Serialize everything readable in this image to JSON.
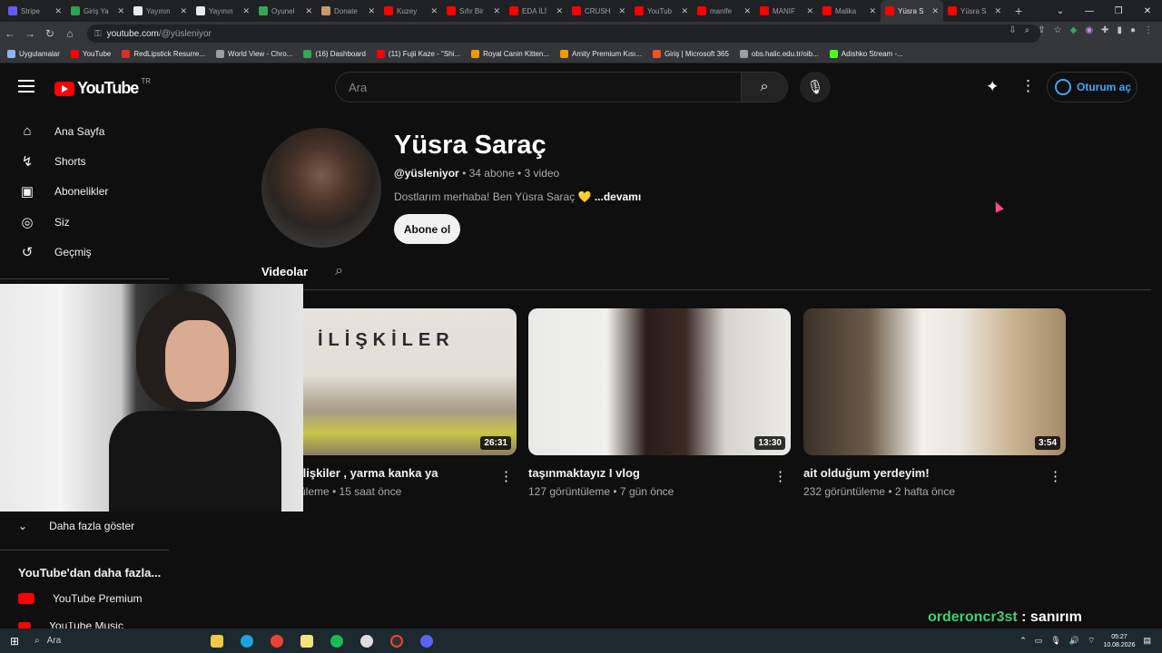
{
  "browser": {
    "tabs": [
      {
        "label": "Stripe",
        "color": "#635bff"
      },
      {
        "label": "Giriş Ya",
        "color": "#2ea44f"
      },
      {
        "label": "Yayının",
        "color": "#e8eaed"
      },
      {
        "label": "Yayının",
        "color": "#e8eaed"
      },
      {
        "label": "Oyunel",
        "color": "#34a853"
      },
      {
        "label": "Donate",
        "color": "#c49a6c"
      },
      {
        "label": "Kuzey",
        "color": "#ff0000"
      },
      {
        "label": "Sıfır Bir",
        "color": "#ff0000"
      },
      {
        "label": "EDA İLİ",
        "color": "#ff0000"
      },
      {
        "label": "CRUSH",
        "color": "#ff0000"
      },
      {
        "label": "YouTub",
        "color": "#ff0000"
      },
      {
        "label": "manife",
        "color": "#ff0000"
      },
      {
        "label": "MANIF",
        "color": "#ff0000"
      },
      {
        "label": "Malika",
        "color": "#ff0000"
      },
      {
        "label": "Yüsra S",
        "color": "#ff0000",
        "active": true
      },
      {
        "label": "Yüsra S",
        "color": "#ff0000"
      }
    ],
    "url_host": "youtube.com",
    "url_path": "/@yüsleniyor",
    "bookmarks": [
      {
        "label": "Uygulamalar",
        "color": "#8ab4f8"
      },
      {
        "label": "YouTube",
        "color": "#ff0000"
      },
      {
        "label": "RedLipstick Resurre...",
        "color": "#d93025"
      },
      {
        "label": "World View - Chro...",
        "color": "#9aa0a6"
      },
      {
        "label": "(16) Dashboard",
        "color": "#34a853"
      },
      {
        "label": "(11) Fujii Kaze - \"Shi...",
        "color": "#ff0000"
      },
      {
        "label": "Royal Canin Kitten...",
        "color": "#f29900"
      },
      {
        "label": "Amity Premium Kısı...",
        "color": "#f29900"
      },
      {
        "label": "Giriş | Microsoft 365",
        "color": "#f25022"
      },
      {
        "label": "obs.halic.edu.tr/oib...",
        "color": "#9aa0a6"
      },
      {
        "label": "Adishko Stream -...",
        "color": "#53fc18"
      }
    ]
  },
  "youtube": {
    "logo_text": "YouTube",
    "logo_region": "TR",
    "search_placeholder": "Ara",
    "sign_in": "Oturum aç",
    "nav": [
      {
        "label": "Ana Sayfa",
        "icon": "home-icon"
      },
      {
        "label": "Shorts",
        "icon": "shorts-icon"
      },
      {
        "label": "Abonelikler",
        "icon": "subscriptions-icon"
      },
      {
        "label": "Siz",
        "icon": "user-icon"
      },
      {
        "label": "Geçmiş",
        "icon": "history-icon"
      }
    ],
    "show_more": "Daha fazla göster",
    "from_youtube": "YouTube'dan daha fazla...",
    "premium": "YouTube Premium",
    "music": "YouTube Music"
  },
  "channel": {
    "name": "Yüsra Saraç",
    "handle": "@yüsleniyor",
    "stats": " • 34 abone • 3 video",
    "description": "Dostlarım merhaba! Ben Yüsra Saraç 💛",
    "more": "...devamı",
    "subscribe": "Abone ol",
    "tab_videos": "Videolar"
  },
  "videos": [
    {
      "title": "ilişkiler , yarma kanka ya",
      "meta": "üleme • 15 saat önce",
      "duration": "26:31",
      "thumb_text": "İLİŞKİLER"
    },
    {
      "title": "taşınmaktayız I vlog",
      "meta": "127 görüntüleme • 7 gün önce",
      "duration": "13:30"
    },
    {
      "title": "ait olduğum yerdeyim!",
      "meta": "232 görüntüleme • 2 hafta önce",
      "duration": "3:54"
    }
  ],
  "overlay": {
    "user": "orderoncr3st",
    "message": " : sanırım"
  },
  "taskbar": {
    "search": "Ara",
    "time": "05:27",
    "date": "10.08.2026"
  }
}
